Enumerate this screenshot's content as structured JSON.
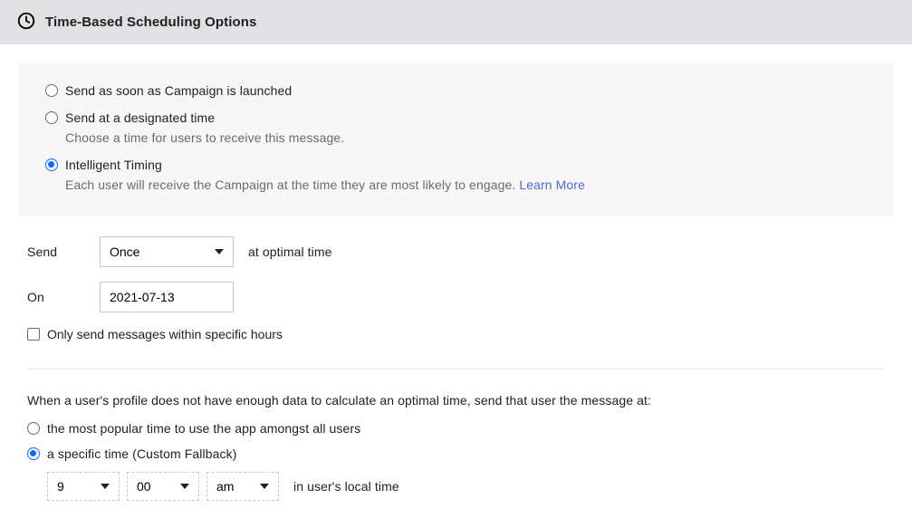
{
  "header": {
    "title": "Time-Based Scheduling Options"
  },
  "schedule_options": {
    "soon": {
      "label": "Send as soon as Campaign is launched"
    },
    "designated": {
      "label": "Send at a designated time",
      "help": "Choose a time for users to receive this message."
    },
    "intelligent": {
      "label": "Intelligent Timing",
      "help": "Each user will receive the Campaign at the time they are most likely to engage. ",
      "learn": "Learn More"
    }
  },
  "send": {
    "label": "Send",
    "freq_value": "Once",
    "suffix": "at optimal time",
    "on_label": "On",
    "date_value": "2021-07-13",
    "hours_checkbox_label": "Only send messages within specific hours"
  },
  "fallback": {
    "question": "When a user's profile does not have enough data to calculate an optimal time, send that user the message at:",
    "popular": {
      "label": "the most popular time to use the app amongst all users"
    },
    "specific": {
      "label": "a specific time (Custom Fallback)"
    },
    "hour": "9",
    "minute": "00",
    "period": "am",
    "tz_note": "in user's local time"
  }
}
